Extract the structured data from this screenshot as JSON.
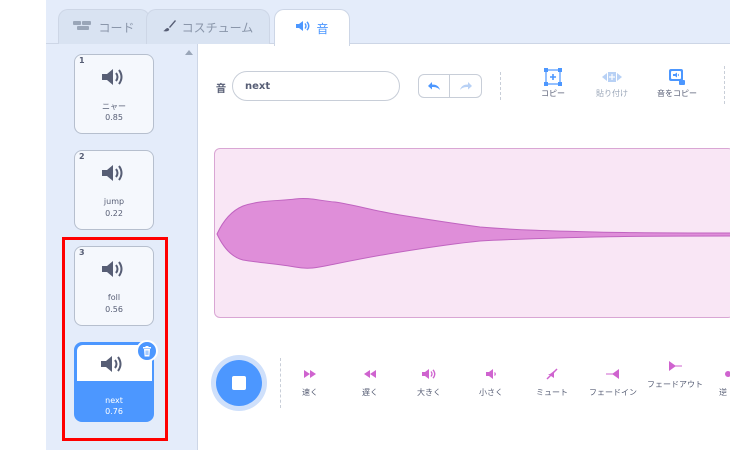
{
  "tabs": [
    {
      "label": "コード",
      "icon": "code-icon"
    },
    {
      "label": "コスチューム",
      "icon": "brush-icon"
    },
    {
      "label": "音",
      "icon": "speaker-icon"
    }
  ],
  "sounds": [
    {
      "index": "1",
      "name": "ニャー",
      "duration": "0.85"
    },
    {
      "index": "2",
      "name": "jump",
      "duration": "0.22"
    },
    {
      "index": "3",
      "name": "foll",
      "duration": "0.56"
    },
    {
      "index": "4",
      "name": "next",
      "duration": "0.76"
    }
  ],
  "selected_sound_index": 4,
  "editor": {
    "sound_label": "音",
    "sound_name_value": "next",
    "tools": [
      {
        "label": "コピー",
        "icon": "copy-icon",
        "enabled": true
      },
      {
        "label": "貼り付け",
        "icon": "paste-icon",
        "enabled": false
      },
      {
        "label": "音をコピー",
        "icon": "copy-to-new-icon",
        "enabled": true
      }
    ]
  },
  "effects": [
    {
      "label": "速く",
      "icon": "faster-icon"
    },
    {
      "label": "遅く",
      "icon": "slower-icon"
    },
    {
      "label": "大きく",
      "icon": "louder-icon"
    },
    {
      "label": "小さく",
      "icon": "softer-icon"
    },
    {
      "label": "ミュート",
      "icon": "mute-icon"
    },
    {
      "label": "フェードイン",
      "icon": "fade-in-icon"
    },
    {
      "label": "フェードアウト",
      "icon": "fade-out-icon"
    },
    {
      "label": "逆",
      "icon": "reverse-icon"
    }
  ],
  "colors": {
    "accent": "#4c97ff",
    "waveform_fill": "#df8ed9",
    "waveform_stroke": "#c064c0",
    "waveform_bg": "#f9e6f5",
    "highlight": "#ff0000",
    "sidebar_bg": "#e4ecfa"
  }
}
